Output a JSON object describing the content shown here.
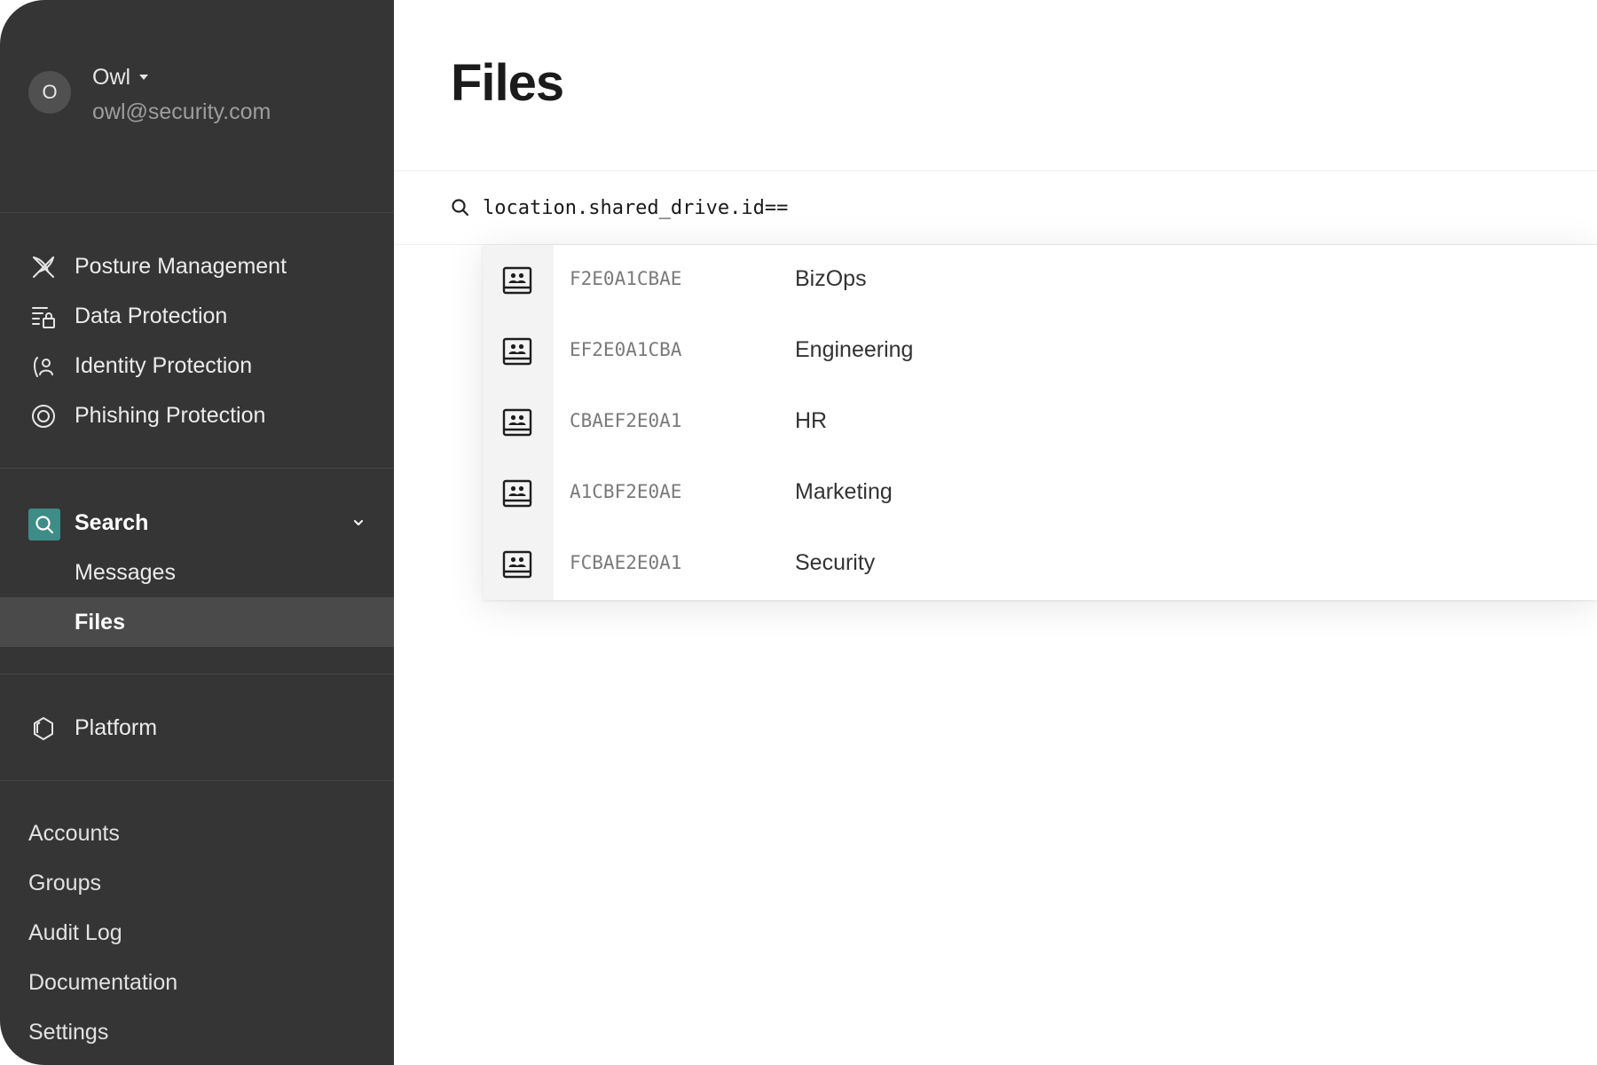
{
  "user": {
    "initial": "O",
    "name": "Owl",
    "email": "owl@security.com"
  },
  "nav_primary": [
    {
      "label": "Posture Management",
      "icon": "posture-icon"
    },
    {
      "label": "Data Protection",
      "icon": "data-lock-icon"
    },
    {
      "label": "Identity Protection",
      "icon": "identity-shield-icon"
    },
    {
      "label": "Phishing Protection",
      "icon": "target-icon"
    }
  ],
  "search_section": {
    "label": "Search",
    "icon": "search-icon",
    "expanded": true,
    "children": [
      {
        "label": "Messages",
        "active": false
      },
      {
        "label": "Files",
        "active": true
      }
    ]
  },
  "platform": {
    "label": "Platform",
    "icon": "hexagon-icon"
  },
  "bottom_links": [
    "Accounts",
    "Groups",
    "Audit Log",
    "Documentation",
    "Settings"
  ],
  "page": {
    "title": "Files"
  },
  "search": {
    "query": "location.shared_drive.id=="
  },
  "suggestions": [
    {
      "id": "F2E0A1CBAE",
      "name": "BizOps",
      "icon": "shared-drive-icon"
    },
    {
      "id": "EF2E0A1CBA",
      "name": "Engineering",
      "icon": "shared-drive-icon"
    },
    {
      "id": "CBAEF2E0A1",
      "name": "HR",
      "icon": "shared-drive-icon"
    },
    {
      "id": "A1CBF2E0AE",
      "name": "Marketing",
      "icon": "shared-drive-icon"
    },
    {
      "id": "FCBAE2E0A1",
      "name": "Security",
      "icon": "shared-drive-icon"
    }
  ],
  "colors": {
    "sidebar_bg": "#353535",
    "active_item_bg": "#4a4a4a",
    "accent": "#3d8c88"
  }
}
